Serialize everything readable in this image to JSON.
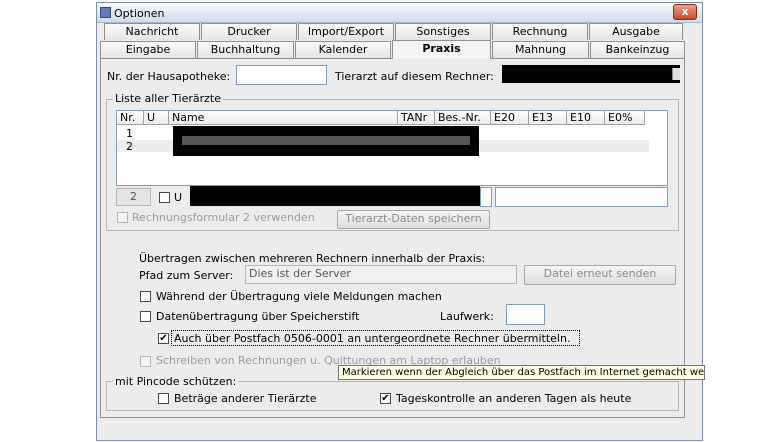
{
  "window": {
    "title": "Optionen",
    "close_glyph": "x"
  },
  "tabs_row1": [
    "Nachricht",
    "Drucker",
    "Import/Export",
    "Sonstiges",
    "Rechnung",
    "Ausgabe"
  ],
  "tabs_row2": [
    "Eingabe",
    "Buchhaltung",
    "Kalender",
    "Praxis",
    "Mahnung",
    "Bankeinzug"
  ],
  "active_tab": "Praxis",
  "fields": {
    "hausapotheke_label": "Nr. der Hausapotheke:",
    "hausapotheke_value": "",
    "tierarzt_label": "Tierarzt auf diesem Rechner:"
  },
  "list": {
    "legend": "Liste aller Tierärzte",
    "columns": [
      "Nr.",
      "U",
      "Name",
      "TANr",
      "Bes.-Nr.",
      "E20",
      "E13",
      "E10",
      "E0%"
    ],
    "rows": [
      {
        "nr": "1"
      },
      {
        "nr": "2"
      }
    ],
    "edit_nr": "2",
    "edit_u_label": "U"
  },
  "rechnungsformular": {
    "label": "Rechnungsformular 2 verwenden",
    "checked": false
  },
  "buttons": {
    "save_vet": "Tierarzt-Daten speichern",
    "resend": "Datei erneut senden"
  },
  "transfer": {
    "heading": "Übertragen zwischen mehreren Rechnern innerhalb der Praxis:",
    "server_path_label": "Pfad zum Server:",
    "server_path_value": "Dies ist der Server",
    "opt_messages": "Während der Übertragung viele Meldungen machen",
    "opt_stick": "Datenübertragung über Speicherstift",
    "laufwerk_label": "Laufwerk:",
    "opt_postfach": "Auch über Postfach 0506-0001 an untergeordnete Rechner übermitteln.",
    "opt_laptop": "Schreiben von Rechnungen u. Quittungen am Laptop erlauben",
    "checks": {
      "messages": "",
      "stick": "",
      "postfach": "✔",
      "laptop": ""
    }
  },
  "tooltip": "Markieren wenn der Abgleich über das Postfach im Internet gemacht werden soll.",
  "pincode": {
    "legend": "mit Pincode schützen:",
    "opt_other_vets": "Beträge anderer Tierärzte",
    "opt_daily": "Tageskontrolle an anderen Tagen als heute",
    "checks": {
      "other_vets": "",
      "daily": "✔"
    }
  },
  "colors": {
    "accent": "#7f9db9",
    "close": "#c74a32"
  }
}
